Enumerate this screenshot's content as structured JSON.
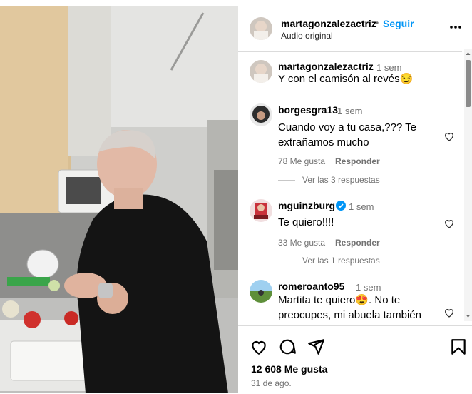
{
  "post": {
    "username": "martagonzalezactriz",
    "separator": "•",
    "follow_label": "Seguir",
    "audio": "Audio original",
    "more_icon": "more-horizontal-icon"
  },
  "comments": [
    {
      "username": "martagonzalezactriz",
      "time": "1 sem",
      "text": "Y con el camisón al revés😏",
      "verified": false
    },
    {
      "username": "borgesgra13",
      "time": "1 sem",
      "text": "Cuando voy a tu casa,??? Te extrañamos mucho",
      "likes": "78 Me gusta",
      "reply": "Responder",
      "view_replies": "Ver las 3 respuestas",
      "verified": false
    },
    {
      "username": "mguinzburg",
      "time": "1 sem",
      "text": "Te quiero!!!!",
      "likes": "33 Me gusta",
      "reply": "Responder",
      "view_replies": "Ver las 1 respuestas",
      "verified": true
    },
    {
      "username": "romeroanto95",
      "time": "1 sem",
      "text": "Martita te quiero😍. No te preocupes, mi abuela también",
      "verified": false
    }
  ],
  "footer": {
    "likes": "12 608 Me gusta",
    "date": "31 de ago.",
    "icons": [
      "heart-icon",
      "comment-icon",
      "share-icon",
      "bookmark-icon"
    ]
  },
  "colors": {
    "link": "#0095f6",
    "muted": "#737373",
    "border": "#dbdbdb",
    "verified": "#0095f6"
  }
}
